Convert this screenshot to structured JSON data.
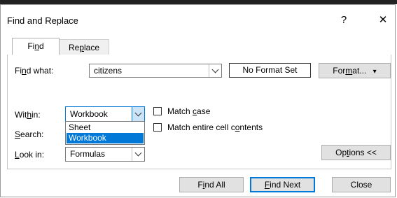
{
  "dialog": {
    "title": "Find and Replace",
    "help_label": "?",
    "close_label": "✕"
  },
  "tabs": [
    {
      "label_pre": "Fi",
      "label_ul": "n",
      "label_post": "d",
      "active": true
    },
    {
      "label_pre": "Re",
      "label_ul": "p",
      "label_post": "lace",
      "active": false
    }
  ],
  "find": {
    "label_pre": "Fi",
    "label_ul": "n",
    "label_post": "d what:",
    "value": "citizens",
    "format_status": "No Format Set",
    "format_button_pre": "For",
    "format_button_ul": "m",
    "format_button_post": "at...",
    "format_button_arrow": "▾"
  },
  "within": {
    "label_pre": "Wit",
    "label_ul": "h",
    "label_post": "in:",
    "value": "Workbook",
    "options": [
      "Sheet",
      "Workbook"
    ],
    "selected_option": "Workbook"
  },
  "search": {
    "label_pre": "",
    "label_ul": "S",
    "label_post": "earch:"
  },
  "look_in": {
    "label_pre": "",
    "label_ul": "L",
    "label_post": "ook in:",
    "value": "Formulas"
  },
  "options": {
    "match_case_pre": "Match ",
    "match_case_ul": "c",
    "match_case_post": "ase",
    "match_case_checked": false,
    "match_entire_pre": "Match entire cell c",
    "match_entire_ul": "o",
    "match_entire_post": "ntents",
    "match_entire_checked": false,
    "options_button_pre": "Op",
    "options_button_ul": "t",
    "options_button_post": "ions <<"
  },
  "buttons": {
    "find_all_pre": "F",
    "find_all_ul": "i",
    "find_all_post": "nd All",
    "find_next_pre": "",
    "find_next_ul": "F",
    "find_next_post": "ind Next",
    "close": "Close"
  },
  "colors": {
    "accent": "#0078d7",
    "button_face": "#e1e1e1"
  }
}
